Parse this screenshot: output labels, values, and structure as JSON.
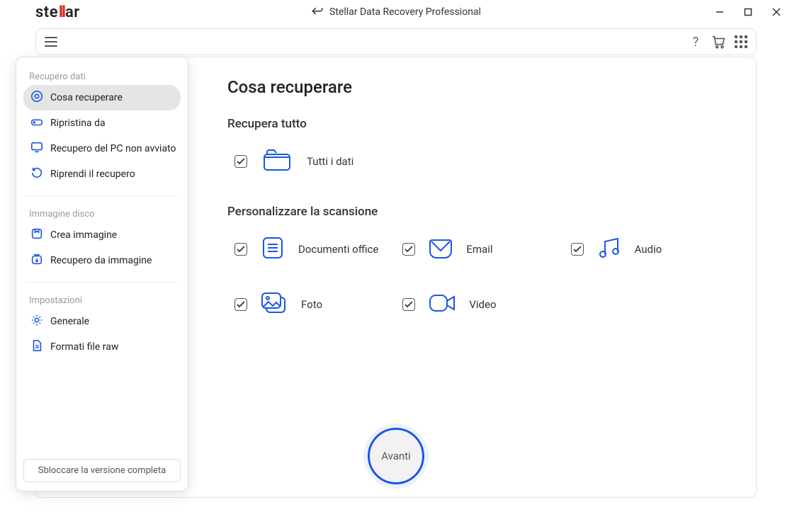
{
  "app": {
    "logo_pre": "ste",
    "logo_mid": "ll",
    "logo_post": "ar",
    "title": "Stellar Data Recovery Professional"
  },
  "sidebar": {
    "groups": {
      "recovery": "Recupero dati",
      "image": "Immagine disco",
      "settings": "Impostazioni"
    },
    "items": {
      "what": "Cosa recuperare",
      "from": "Ripristina da",
      "nonboot": "Recupero del PC non avviato",
      "resume": "Riprendi il recupero",
      "create_img": "Crea immagine",
      "recover_img": "Recupero da immagine",
      "general": "Generale",
      "raw": "Formati file raw"
    },
    "unlock": "Sbloccare la versione completa"
  },
  "content": {
    "page_title": "Cosa recuperare",
    "section_all": "Recupera tutto",
    "all_data": "Tutti i dati",
    "section_custom": "Personalizzare la scansione",
    "items": {
      "office": "Documenti office",
      "email": "Email",
      "audio": "Audio",
      "photo": "Foto",
      "video": "Video"
    },
    "next": "Avanti"
  }
}
